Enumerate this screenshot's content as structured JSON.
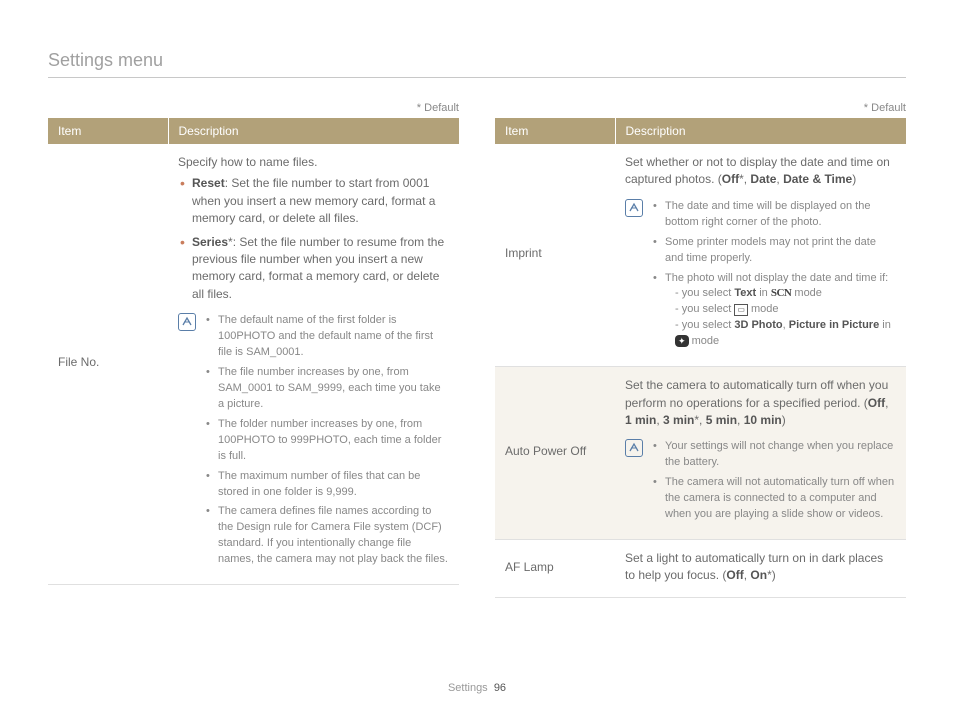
{
  "page_title": "Settings menu",
  "default_label": "* Default",
  "table_headers": {
    "item": "Item",
    "description": "Description"
  },
  "footer": {
    "section": "Settings",
    "page": "96"
  },
  "left": {
    "file_no": {
      "item": "File No.",
      "intro": "Specify how to name files.",
      "reset_label": "Reset",
      "reset_text": ": Set the file number to start from 0001 when you insert a new memory card, format a memory card, or delete all files.",
      "series_label": "Series",
      "series_text": "*: Set the file number to resume from the previous file number when you insert a new memory card, format a memory card, or delete all files.",
      "notes": [
        "The default name of the first folder is 100PHOTO and the default name of the first file is SAM_0001.",
        "The file number increases by one, from SAM_0001 to SAM_9999, each time you take a picture.",
        "The folder number increases by one, from 100PHOTO to 999PHOTO, each time a folder is full.",
        "The maximum number of files that can be stored in one folder is 9,999.",
        "The camera defines file names according to the Design rule for Camera File system (DCF) standard. If you intentionally change file names, the camera may not play back the files."
      ]
    }
  },
  "right": {
    "imprint": {
      "item": "Imprint",
      "desc_prefix": "Set whether or not to display the date and time on captured photos. (",
      "opt_off": "Off",
      "comma": ", ",
      "opt_date": "Date",
      "opt_datetime": "Date & Time",
      "close": ")",
      "notes": {
        "n1": "The date and time will be displayed on the bottom right corner of the photo.",
        "n2": "Some printer models may not print the date and time properly.",
        "n3": "The photo will not display the date and time if:",
        "d1a": "you select ",
        "d1_text": "Text",
        "d1b": " in ",
        "d1_mode": "SCN",
        "d1c": " mode",
        "d2a": "you select ",
        "d2_mode_aria": "panorama",
        "d2b": " mode",
        "d3a": "you select ",
        "d3_text": "3D Photo",
        "d3b": ", ",
        "d3_text2": "Picture in Picture",
        "d3c": " in ",
        "d3_mode_aria": "magic",
        "d3d": " mode"
      }
    },
    "auto_power_off": {
      "item": "Auto Power Off",
      "desc_prefix": "Set the camera to automatically turn off when you perform no operations for a specified period. (",
      "opt_off": "Off",
      "comma": ", ",
      "opt_1": "1 min",
      "opt_3": "3 min",
      "opt_5": "5 min",
      "opt_10": "10 min",
      "close": ")",
      "notes": [
        "Your settings will not change when you replace the battery.",
        "The camera will not automatically turn off when the camera is connected to a computer and when you are playing a slide show or videos."
      ]
    },
    "af_lamp": {
      "item": "AF Lamp",
      "desc_prefix": "Set a light to automatically turn on in dark places to help you focus. (",
      "opt_off": "Off",
      "comma": ", ",
      "opt_on": "On",
      "close": ")"
    }
  }
}
